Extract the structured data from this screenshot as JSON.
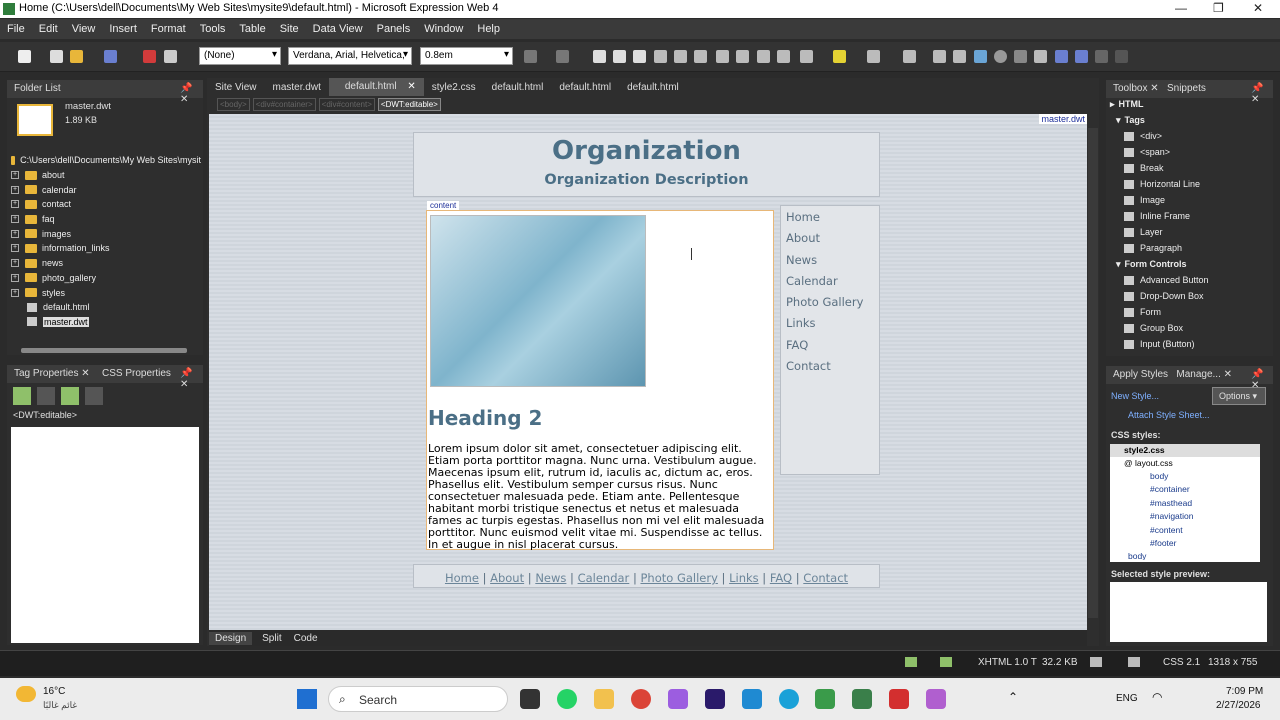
{
  "window": {
    "title": "Home (C:\\Users\\dell\\Documents\\My Web Sites\\mysite9\\default.html) - Microsoft Expression Web 4"
  },
  "menu": [
    "File",
    "Edit",
    "View",
    "Insert",
    "Format",
    "Tools",
    "Table",
    "Site",
    "Data View",
    "Panels",
    "Window",
    "Help"
  ],
  "toolbar": {
    "style_combo": "(None)",
    "font_combo": "Verdana, Arial, Helvetica,",
    "size_combo": "0.8em"
  },
  "folder_list": {
    "title": "Folder List",
    "file_name": "master.dwt",
    "file_size": "1.89 KB",
    "root": "C:\\Users\\dell\\Documents\\My Web Sites\\mysit",
    "folders": [
      "about",
      "calendar",
      "contact",
      "faq",
      "images",
      "information_links",
      "news",
      "photo_gallery",
      "styles"
    ],
    "files": [
      "default.html",
      "master.dwt"
    ]
  },
  "tag_panel": {
    "tab1": "Tag Properties",
    "tab2": "CSS Properties",
    "tag": "<DWT:editable>"
  },
  "doc_tabs": [
    "Site View",
    "master.dwt",
    "default.html",
    "style2.css",
    "default.html",
    "default.html",
    "default.html"
  ],
  "breadcrumb": [
    "<body>",
    "<div#container>",
    "<div#content>",
    "<DWT:editable>"
  ],
  "template_label": "master.dwt",
  "page": {
    "org_title": "Organization",
    "org_desc": "Organization Description",
    "content_tag": "content",
    "heading": "Heading 2",
    "paragraph": "Lorem ipsum dolor sit amet, consectetuer adipiscing elit. Etiam porta porttitor magna. Nunc urna. Vestibulum augue. Maecenas ipsum elit, rutrum id, iaculis ac, dictum ac, eros. Phasellus elit. Vestibulum semper cursus risus. Nunc consectetuer malesuada pede. Etiam ante. Pellentesque habitant morbi tristique senectus et netus et malesuada fames ac turpis egestas. Phasellus non mi vel elit malesuada porttitor. Nunc euismod velit vitae mi. Suspendisse ac tellus. In et augue in nisl placerat cursus.",
    "nav": [
      "Home",
      "About",
      "News",
      "Calendar",
      "Photo Gallery",
      "Links",
      "FAQ",
      "Contact"
    ]
  },
  "view_tabs": [
    "Design",
    "Split",
    "Code"
  ],
  "toolbox": {
    "tab1": "Toolbox",
    "tab2": "Snippets",
    "html": "HTML",
    "tags_label": "Tags",
    "tags": [
      "<div>",
      "<span>",
      "Break",
      "Horizontal Line",
      "Image",
      "Inline Frame",
      "Layer",
      "Paragraph"
    ],
    "form_label": "Form Controls",
    "forms": [
      "Advanced Button",
      "Drop-Down Box",
      "Form",
      "Group Box",
      "Input (Button)"
    ]
  },
  "apply_styles": {
    "tab1": "Apply Styles",
    "tab2": "Manage...",
    "new_style": "New Style...",
    "options": "Options",
    "attach": "Attach Style Sheet...",
    "css_label": "CSS styles:",
    "sheet": "style2.css",
    "layout": "@ layout.css",
    "rules": [
      "body",
      "#container",
      "#masthead",
      "#navigation",
      "#content",
      "#footer"
    ],
    "body2": "body",
    "preview_label": "Selected style preview:"
  },
  "status": {
    "doctype": "XHTML 1.0 T",
    "size": "32.2 KB",
    "css": "CSS 2.1",
    "dims": "1318 x 755"
  },
  "taskbar": {
    "temp": "16°C",
    "weather": "غائم غالبًا",
    "search": "Search",
    "lang": "ENG",
    "time": "7:09 PM",
    "date": "2/27/2026"
  }
}
